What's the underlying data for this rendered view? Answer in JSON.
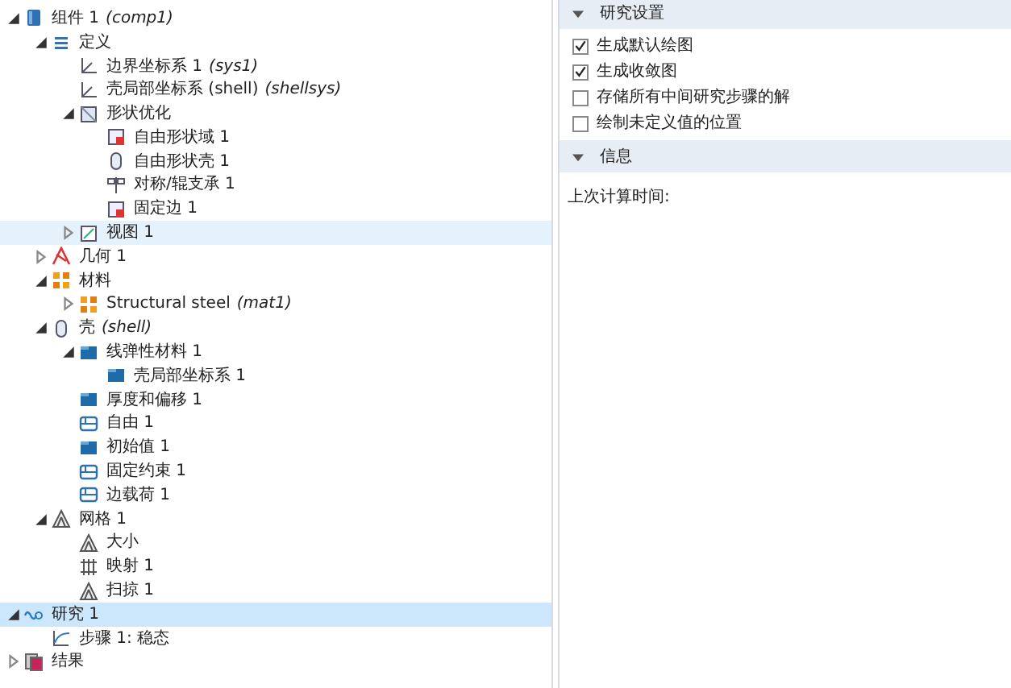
{
  "model_tree": [
    {
      "label": "组件 1",
      "tag": "(comp1)",
      "kind": "component",
      "expanded": true,
      "selected": false,
      "hovered": false,
      "children": [
        {
          "label": "定义",
          "kind": "list",
          "expanded": true,
          "selected": false,
          "hovered": false,
          "children": [
            {
              "label": "边界坐标系 1",
              "tag": "(sys1)",
              "kind": "axes",
              "selected": false,
              "hovered": false
            },
            {
              "label": "壳局部坐标系 (shell)",
              "tag": "(shellsys)",
              "kind": "axes",
              "selected": false,
              "hovered": false
            },
            {
              "label": "形状优化",
              "kind": "frame",
              "expanded": true,
              "selected": false,
              "hovered": false,
              "children": [
                {
                  "label": "自由形状域 1",
                  "kind": "marked",
                  "selected": false,
                  "hovered": false
                },
                {
                  "label": "自由形状壳 1",
                  "kind": "cylinder",
                  "selected": false,
                  "hovered": false
                },
                {
                  "label": "对称/辊支承 1",
                  "kind": "symmetry",
                  "selected": false,
                  "hovered": false
                },
                {
                  "label": "固定边 1",
                  "kind": "marked",
                  "selected": false,
                  "hovered": false
                }
              ]
            },
            {
              "label": "视图 1",
              "kind": "view",
              "expanded": false,
              "selected": false,
              "hovered": true
            }
          ]
        },
        {
          "label": "几何 1",
          "kind": "geometry",
          "expanded": false,
          "selected": false,
          "hovered": false
        },
        {
          "label": "材料",
          "kind": "material",
          "expanded": true,
          "selected": false,
          "hovered": false,
          "children": [
            {
              "label": "Structural steel",
              "tag": "(mat1)",
              "kind": "material",
              "expanded": false,
              "selected": false,
              "hovered": false
            }
          ]
        },
        {
          "label": "壳",
          "tag": "(shell)",
          "kind": "cylinder",
          "expanded": true,
          "selected": false,
          "hovered": false,
          "children": [
            {
              "label": "线弹性材料 1",
              "kind": "folder",
              "expanded": true,
              "selected": false,
              "hovered": false,
              "children": [
                {
                  "label": "壳局部坐标系 1",
                  "kind": "folder",
                  "selected": false,
                  "hovered": false
                }
              ]
            },
            {
              "label": "厚度和偏移 1",
              "kind": "folder",
              "selected": false,
              "hovered": false
            },
            {
              "label": "自由 1",
              "kind": "boundary",
              "selected": false,
              "hovered": false
            },
            {
              "label": "初始值 1",
              "kind": "folder",
              "selected": false,
              "hovered": false
            },
            {
              "label": "固定约束 1",
              "kind": "boundary",
              "selected": false,
              "hovered": false
            },
            {
              "label": "边载荷 1",
              "kind": "boundary",
              "selected": false,
              "hovered": false
            }
          ]
        },
        {
          "label": "网格 1",
          "kind": "mesh",
          "expanded": true,
          "selected": false,
          "hovered": false,
          "children": [
            {
              "label": "大小",
              "kind": "mesh",
              "selected": false,
              "hovered": false
            },
            {
              "label": "映射 1",
              "kind": "grid",
              "selected": false,
              "hovered": false
            },
            {
              "label": "扫掠 1",
              "kind": "mesh",
              "selected": false,
              "hovered": false
            }
          ]
        }
      ]
    },
    {
      "label": "研究 1",
      "kind": "study",
      "expanded": true,
      "selected": true,
      "hovered": false,
      "children": [
        {
          "label": "步骤 1: 稳态",
          "kind": "step",
          "selected": false,
          "hovered": false
        }
      ]
    },
    {
      "label": "结果",
      "kind": "results",
      "expanded": false,
      "selected": false,
      "hovered": false
    }
  ],
  "settings": {
    "sections": [
      {
        "title": "研究设置",
        "expanded": true,
        "options": [
          {
            "label": "生成默认绘图",
            "checked": true
          },
          {
            "label": "生成收敛图",
            "checked": true
          },
          {
            "label": "存储所有中间研究步骤的解",
            "checked": false
          },
          {
            "label": "绘制未定义值的位置",
            "checked": false
          }
        ]
      },
      {
        "title": "信息",
        "expanded": true,
        "text": "上次计算时间:"
      }
    ]
  }
}
